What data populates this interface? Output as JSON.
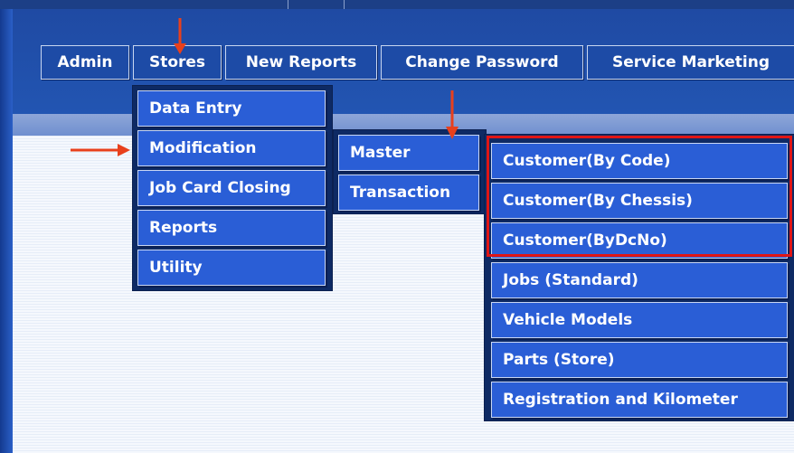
{
  "colors": {
    "header": "#2255b2",
    "menu_item": "#2a5ed6",
    "highlight": "#e01515",
    "arrow": "#e8401c"
  },
  "main_nav": [
    "Admin",
    "Stores",
    "New Reports",
    "Change Password",
    "Service Marketing"
  ],
  "stores_menu": [
    "Data Entry",
    "Modification",
    "Job Card Closing",
    "Reports",
    "Utility"
  ],
  "modification_menu": [
    "Master",
    "Transaction"
  ],
  "master_menu": [
    "Customer(By Code)",
    "Customer(By Chessis)",
    "Customer(ByDcNo)",
    "Jobs (Standard)",
    "Vehicle Models",
    "Parts (Store)",
    "Registration and Kilometer"
  ],
  "annotations": [
    "arrow-pointing-stores",
    "arrow-pointing-modification",
    "arrow-pointing-master",
    "red-box-customer-items"
  ]
}
